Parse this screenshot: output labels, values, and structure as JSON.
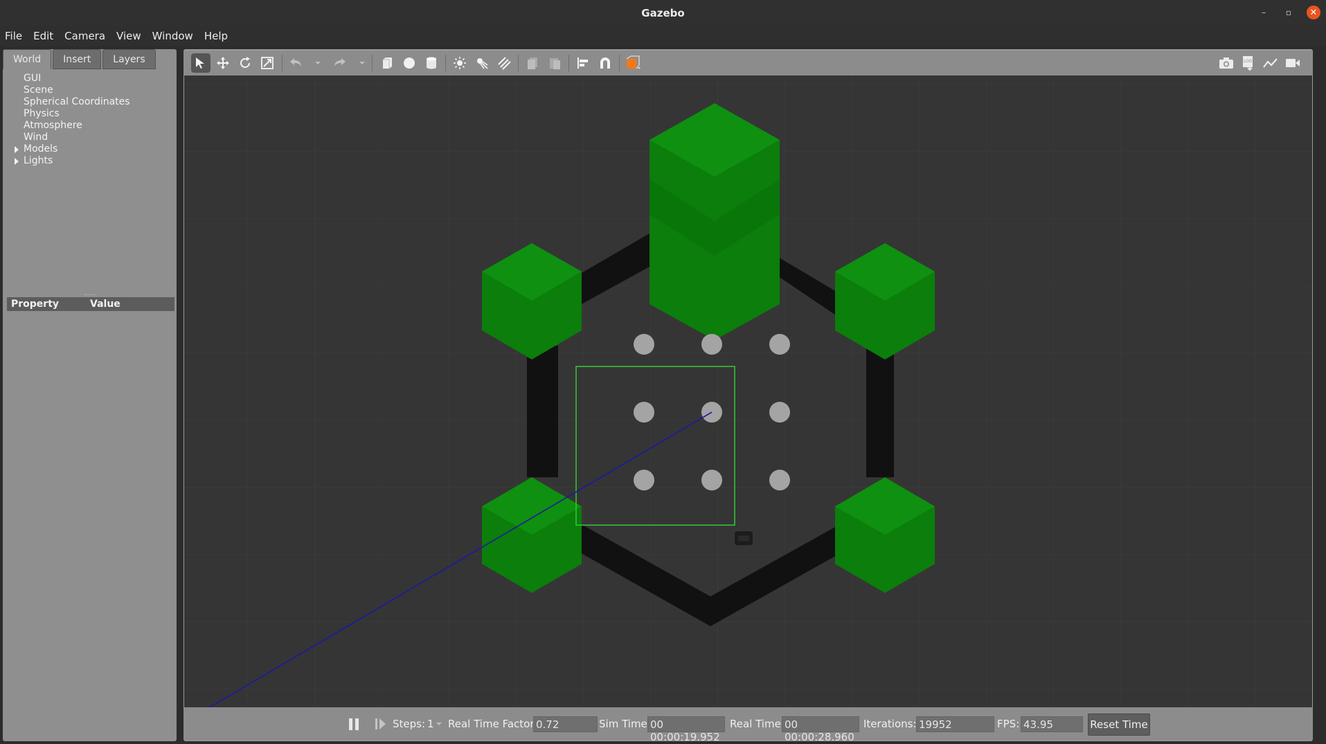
{
  "window": {
    "title": "Gazebo",
    "controls": {
      "minimize": "–",
      "maximize": "▫",
      "close": "✕"
    }
  },
  "menubar": {
    "items": [
      "File",
      "Edit",
      "Camera",
      "View",
      "Window",
      "Help"
    ]
  },
  "left_panel": {
    "tabs": [
      "World",
      "Insert",
      "Layers"
    ],
    "active_tab": "World",
    "tree": [
      {
        "label": "GUI",
        "expandable": false
      },
      {
        "label": "Scene",
        "expandable": false
      },
      {
        "label": "Spherical Coordinates",
        "expandable": false
      },
      {
        "label": "Physics",
        "expandable": false
      },
      {
        "label": "Atmosphere",
        "expandable": false
      },
      {
        "label": "Wind",
        "expandable": false
      },
      {
        "label": "Models",
        "expandable": true
      },
      {
        "label": "Lights",
        "expandable": true
      }
    ],
    "property_header": {
      "property": "Property",
      "value": "Value"
    }
  },
  "toolbar": {
    "tools": [
      {
        "name": "select-mode-icon",
        "glyph": "➚",
        "active": true
      },
      {
        "name": "translate-mode-icon",
        "glyph": "✥"
      },
      {
        "name": "rotate-mode-icon",
        "glyph": "⟳"
      },
      {
        "name": "scale-mode-icon",
        "glyph": "⤢"
      },
      {
        "name": "undo-icon",
        "glyph": "↶",
        "dim": true
      },
      {
        "name": "redo-icon",
        "glyph": "↷",
        "dim": true
      },
      {
        "name": "box-shape-icon",
        "glyph": "■"
      },
      {
        "name": "sphere-shape-icon",
        "glyph": "●"
      },
      {
        "name": "cylinder-shape-icon",
        "glyph": "▮"
      },
      {
        "name": "point-light-icon",
        "glyph": "☀"
      },
      {
        "name": "spot-light-icon",
        "glyph": "✺"
      },
      {
        "name": "directional-light-icon",
        "glyph": "⫽"
      },
      {
        "name": "copy-icon",
        "glyph": "❐",
        "dim": true
      },
      {
        "name": "paste-icon",
        "glyph": "❏",
        "dim": true
      },
      {
        "name": "align-icon",
        "glyph": "⊫"
      },
      {
        "name": "snap-icon",
        "glyph": "∩"
      },
      {
        "name": "view-angle-icon",
        "glyph": "◧"
      }
    ],
    "right_tools": [
      {
        "name": "screenshot-icon",
        "glyph": "📷"
      },
      {
        "name": "log-icon",
        "glyph": "▤"
      },
      {
        "name": "plot-icon",
        "glyph": "〰"
      },
      {
        "name": "video-record-icon",
        "glyph": "▶"
      }
    ]
  },
  "scene": {
    "colors": {
      "background": "#353535",
      "cube": "#0a7a0a",
      "wall": "#101010",
      "ball": "#a4a4a4",
      "selection": "#33cc33",
      "axis": "#1a1aa0"
    }
  },
  "bottom_bar": {
    "steps_label": "Steps:",
    "steps_value": "1",
    "rtf_label": "Real Time Factor:",
    "rtf_value": "0.72",
    "sim_time_label": "Sim Time:",
    "sim_time_value": "00 00:00:19.952",
    "real_time_label": "Real Time:",
    "real_time_value": "00 00:00:28.960",
    "iterations_label": "Iterations:",
    "iterations_value": "19952",
    "fps_label": "FPS:",
    "fps_value": "43.95",
    "reset_label": "Reset Time"
  }
}
